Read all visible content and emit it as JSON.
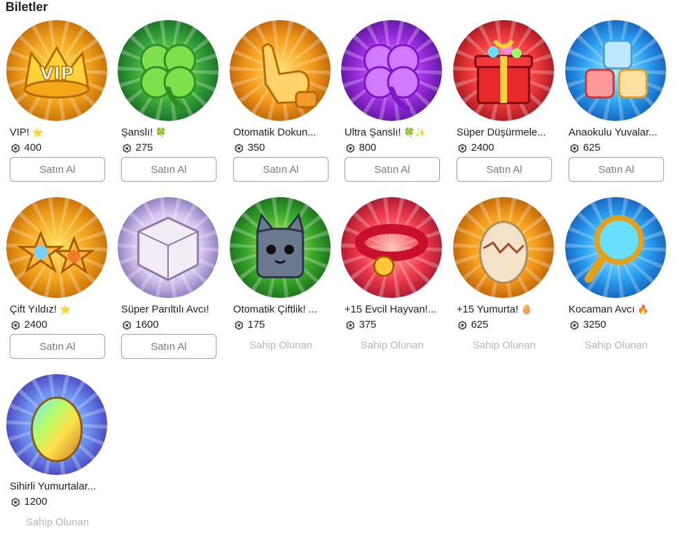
{
  "section": {
    "title": "Biletler"
  },
  "labels": {
    "buy": "Satın Al",
    "owned": "Sahip Olunan"
  },
  "items": [
    {
      "name": "VIP!",
      "emoji": "⭐",
      "price": "400",
      "owned": false,
      "art": "vip-crown-icon",
      "colors": [
        "#ffe45c",
        "#f0a21a",
        "#b55a00"
      ]
    },
    {
      "name": "Şanslı!",
      "emoji": "🍀",
      "price": "275",
      "owned": false,
      "art": "clover-icon",
      "colors": [
        "#b9f56a",
        "#37a83a",
        "#0e5a1c"
      ]
    },
    {
      "name": "Otomatik Dokun...",
      "emoji": "",
      "price": "350",
      "owned": false,
      "art": "tap-hand-icon",
      "colors": [
        "#ffe36a",
        "#f39a1b",
        "#a84e00"
      ]
    },
    {
      "name": "Ultra Şanslı!",
      "emoji": "🍀✨",
      "price": "800",
      "owned": false,
      "art": "purple-clover-icon",
      "colors": [
        "#f0a0ff",
        "#9b2fe0",
        "#4a0b87"
      ]
    },
    {
      "name": "Süper Düşürmele...",
      "emoji": "",
      "price": "2400",
      "owned": false,
      "art": "gift-box-icon",
      "colors": [
        "#ffb0a0",
        "#ef3a3a",
        "#8a0d18"
      ]
    },
    {
      "name": "Anaokulu Yuvalar...",
      "emoji": "",
      "price": "625",
      "owned": false,
      "art": "dice-cubes-icon",
      "colors": [
        "#a6f0ff",
        "#2a9ff0",
        "#0c4aa8"
      ]
    },
    {
      "name": "Çift Yıldız!",
      "emoji": "⭐",
      "price": "2400",
      "owned": false,
      "art": "double-star-icon",
      "colors": [
        "#ffe45c",
        "#f0a21a",
        "#b55a00"
      ]
    },
    {
      "name": "Süper Parıltılı Avcı!",
      "emoji": "",
      "price": "1600",
      "owned": false,
      "art": "shiny-cube-icon",
      "colors": [
        "#ffffff",
        "#d8c8f0",
        "#6b58a8"
      ]
    },
    {
      "name": "Otomatik Çiftlik! ...",
      "emoji": "",
      "price": "175",
      "owned": true,
      "art": "cat-icon",
      "colors": [
        "#d6ff7a",
        "#3aaa2a",
        "#0d5a17"
      ]
    },
    {
      "name": "+15 Evcil Hayvan!...",
      "emoji": "",
      "price": "375",
      "owned": true,
      "art": "pet-collar-icon",
      "colors": [
        "#ffc0b0",
        "#ef3a4a",
        "#8a0d28"
      ]
    },
    {
      "name": "+15 Yumurta!",
      "emoji": "🥚",
      "price": "625",
      "owned": true,
      "art": "egg-icon",
      "colors": [
        "#ffe36a",
        "#f39a1b",
        "#a84e00"
      ]
    },
    {
      "name": "Kocaman Avcı",
      "emoji": "🔥",
      "price": "3250",
      "owned": true,
      "art": "magnifier-icon",
      "colors": [
        "#a6f0ff",
        "#2a9ff0",
        "#0c4aa8"
      ]
    },
    {
      "name": "Sihirli Yumurtalar...",
      "emoji": "",
      "price": "1200",
      "owned": true,
      "art": "rainbow-egg-icon",
      "colors": [
        "#9fe8ff",
        "#6b8df0",
        "#3a2aa8"
      ]
    }
  ]
}
